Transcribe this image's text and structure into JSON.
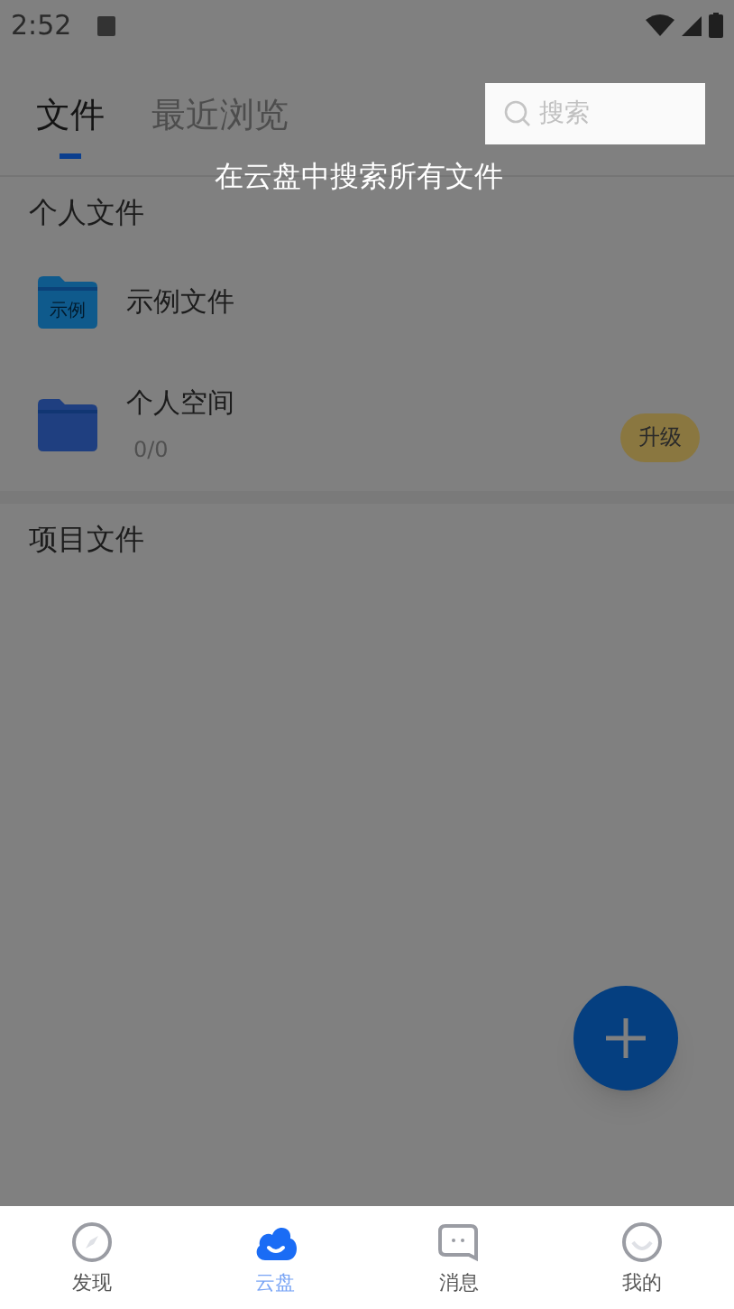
{
  "status_bar": {
    "time": "2:52"
  },
  "tabs": [
    {
      "label": "文件",
      "selected": true
    },
    {
      "label": "最近浏览",
      "selected": false
    }
  ],
  "search": {
    "placeholder": "搜索"
  },
  "hint": "在云盘中搜索所有文件",
  "sections": [
    {
      "title": "个人文件",
      "items": [
        {
          "name": "示例文件",
          "folder_label": "示例",
          "color": "#0f5a8c"
        },
        {
          "name": "个人空间",
          "detail": "0/0",
          "action": "升级",
          "color": "#1f3f80"
        }
      ]
    },
    {
      "title": "项目文件"
    }
  ],
  "nav": [
    {
      "label": "发现",
      "kind": "compass",
      "selected": false
    },
    {
      "label": "云盘",
      "kind": "cloud",
      "selected": true
    },
    {
      "label": "消息",
      "kind": "chat",
      "selected": false
    },
    {
      "label": "我的",
      "kind": "smile",
      "selected": false
    }
  ]
}
